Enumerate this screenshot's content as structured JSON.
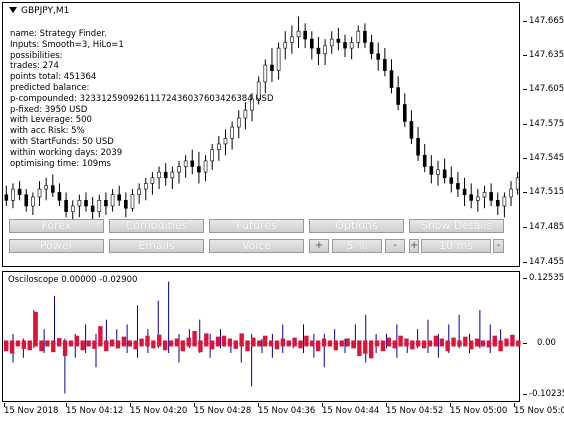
{
  "chart_window": {
    "symbol": "GBPJPY,M1",
    "info_lines": [
      "name: Strategy Finder.",
      "Inputs: Smooth=3, HiLo=1",
      "possibilities:",
      "trades: 274",
      "points total: 451364",
      "predicted balance:",
      "p-compounded: 32331259092611172436037603426384 USD",
      "p-fixed: 3950 USD",
      "with Leverage: 500",
      "with acc Risk: 5%",
      "with StartFunds: 50 USD",
      "within working days: 2039",
      "optimising time: 109ms"
    ]
  },
  "buttons": {
    "row1": [
      {
        "label": "Forex",
        "name": "forex-button"
      },
      {
        "label": "Comodities",
        "name": "comodities-button"
      },
      {
        "label": "Futures",
        "name": "futures-button"
      },
      {
        "label": "Options",
        "name": "options-button"
      },
      {
        "label": "Show Details",
        "name": "show-details-button"
      }
    ],
    "row2": {
      "power": "Power",
      "emails": "Emails",
      "voice": "Voice",
      "risk_plus": "+",
      "risk_value": "5 %",
      "risk_minus": "-",
      "time_plus": "+",
      "time_value": "10 ms",
      "time_minus": "-"
    }
  },
  "oscillator": {
    "title": "Osciloscope 0.00000 -0.02900"
  },
  "colors": {
    "candle": "#000000",
    "osc_bar": "#dc143c",
    "osc_line": "#00008b"
  },
  "chart_data": [
    {
      "type": "candlestick",
      "title": "GBPJPY,M1",
      "y_tick_labels": [
        "147.665",
        "147.635",
        "147.605",
        "147.575",
        "147.545",
        "147.515",
        "147.485",
        "147.455"
      ],
      "ylim": [
        147.445,
        147.68
      ],
      "x_tick_labels": [
        "15 Nov 2018",
        "15 Nov 04:12",
        "15 Nov 04:20",
        "15 Nov 04:28",
        "15 Nov 04:36",
        "15 Nov 04:44",
        "15 Nov 04:52",
        "15 Nov 05:00",
        "15 Nov 05:0"
      ],
      "candles": [
        [
          147.51,
          147.518,
          147.5,
          147.505
        ],
        [
          147.505,
          147.52,
          147.498,
          147.515
        ],
        [
          147.515,
          147.522,
          147.505,
          147.51
        ],
        [
          147.51,
          147.515,
          147.495,
          147.5
        ],
        [
          147.5,
          147.512,
          147.492,
          147.508
        ],
        [
          147.508,
          147.522,
          147.5,
          147.515
        ],
        [
          147.515,
          147.525,
          147.505,
          147.518
        ],
        [
          147.518,
          147.528,
          147.508,
          147.512
        ],
        [
          147.512,
          147.52,
          147.5,
          147.505
        ],
        [
          147.505,
          147.512,
          147.49,
          147.495
        ],
        [
          147.495,
          147.505,
          147.485,
          147.5
        ],
        [
          147.5,
          147.51,
          147.49,
          147.505
        ],
        [
          147.505,
          147.512,
          147.495,
          147.5
        ],
        [
          147.5,
          147.508,
          147.488,
          147.495
        ],
        [
          147.495,
          147.51,
          147.49,
          147.505
        ],
        [
          147.505,
          147.512,
          147.492,
          147.5
        ],
        [
          147.5,
          147.515,
          147.495,
          147.51
        ],
        [
          147.51,
          147.518,
          147.5,
          147.505
        ],
        [
          147.505,
          147.512,
          147.49,
          147.498
        ],
        [
          147.498,
          147.515,
          147.495,
          147.51
        ],
        [
          147.51,
          147.52,
          147.502,
          147.515
        ],
        [
          147.515,
          147.525,
          147.505,
          147.52
        ],
        [
          147.52,
          147.53,
          147.51,
          147.525
        ],
        [
          147.525,
          147.535,
          147.515,
          147.53
        ],
        [
          147.53,
          147.538,
          147.518,
          147.525
        ],
        [
          147.525,
          147.535,
          147.515,
          147.53
        ],
        [
          147.53,
          147.54,
          147.52,
          147.535
        ],
        [
          147.535,
          147.545,
          147.525,
          147.54
        ],
        [
          147.54,
          147.55,
          147.528,
          147.535
        ],
        [
          147.535,
          147.548,
          147.52,
          147.53
        ],
        [
          147.53,
          147.545,
          147.522,
          147.54
        ],
        [
          147.54,
          147.555,
          147.532,
          147.55
        ],
        [
          147.55,
          147.562,
          147.54,
          147.555
        ],
        [
          147.555,
          147.568,
          147.545,
          147.56
        ],
        [
          147.56,
          147.575,
          147.55,
          147.57
        ],
        [
          147.57,
          147.585,
          147.56,
          147.578
        ],
        [
          147.578,
          147.592,
          147.568,
          147.585
        ],
        [
          147.585,
          147.6,
          147.575,
          147.595
        ],
        [
          147.595,
          147.615,
          147.59,
          147.61
        ],
        [
          147.61,
          147.63,
          147.6,
          147.625
        ],
        [
          147.625,
          147.64,
          147.61,
          147.62
        ],
        [
          147.62,
          147.645,
          147.612,
          147.64
        ],
        [
          147.64,
          147.655,
          147.63,
          147.645
        ],
        [
          147.645,
          147.66,
          147.635,
          147.65
        ],
        [
          147.65,
          147.668,
          147.64,
          147.655
        ],
        [
          147.655,
          147.662,
          147.64,
          147.648
        ],
        [
          147.648,
          147.655,
          147.63,
          147.64
        ],
        [
          147.64,
          147.65,
          147.625,
          147.635
        ],
        [
          147.635,
          147.648,
          147.625,
          147.642
        ],
        [
          147.642,
          147.655,
          147.635,
          147.648
        ],
        [
          147.648,
          147.658,
          147.638,
          147.645
        ],
        [
          147.645,
          147.652,
          147.632,
          147.64
        ],
        [
          147.64,
          147.65,
          147.63,
          147.645
        ],
        [
          147.645,
          147.66,
          147.64,
          147.655
        ],
        [
          147.655,
          147.662,
          147.64,
          147.645
        ],
        [
          147.645,
          147.652,
          147.63,
          147.635
        ],
        [
          147.635,
          147.645,
          147.62,
          147.63
        ],
        [
          147.63,
          147.64,
          147.615,
          147.62
        ],
        [
          147.62,
          147.63,
          147.6,
          147.605
        ],
        [
          147.605,
          147.615,
          147.585,
          147.59
        ],
        [
          147.59,
          147.6,
          147.57,
          147.575
        ],
        [
          147.575,
          147.585,
          147.555,
          147.56
        ],
        [
          147.56,
          147.57,
          147.54,
          147.545
        ],
        [
          147.545,
          147.555,
          147.53,
          147.535
        ],
        [
          147.535,
          147.545,
          147.52,
          147.528
        ],
        [
          147.528,
          147.54,
          147.518,
          147.532
        ],
        [
          147.532,
          147.542,
          147.52,
          147.525
        ],
        [
          147.525,
          147.535,
          147.512,
          147.52
        ],
        [
          147.52,
          147.53,
          147.508,
          147.515
        ],
        [
          147.515,
          147.525,
          147.5,
          147.51
        ],
        [
          147.51,
          147.52,
          147.498,
          147.505
        ],
        [
          147.505,
          147.515,
          147.495,
          147.508
        ],
        [
          147.508,
          147.518,
          147.498,
          147.512
        ],
        [
          147.512,
          147.52,
          147.5,
          147.505
        ],
        [
          147.505,
          147.512,
          147.492,
          147.5
        ],
        [
          147.5,
          147.512,
          147.49,
          147.508
        ],
        [
          147.508,
          147.522,
          147.5,
          147.515
        ],
        [
          147.515,
          147.53,
          147.51,
          147.525
        ]
      ]
    },
    {
      "type": "bar",
      "title": "Osciloscope 0.00000 -0.02900",
      "y_tick_labels": [
        "0.12535",
        "0.00",
        "-0.10235"
      ],
      "ylim": [
        -0.125,
        0.15
      ],
      "values": [
        -0.01,
        -0.015,
        0.0,
        -0.005,
        -0.008,
        0.06,
        -0.01,
        0.0,
        -0.012,
        0.005,
        -0.02,
        0.0,
        0.01,
        -0.008,
        0.0,
        -0.005,
        0.03,
        -0.01,
        0.002,
        -0.004,
        0.008,
        0.0,
        -0.006,
        0.004,
        0.01,
        -0.004,
        0.012,
        -0.008,
        0.0,
        0.004,
        -0.01,
        0.006,
        0.02,
        -0.012,
        0.015,
        -0.006,
        0.008,
        0.01,
        0.004,
        -0.005,
        0.015,
        -0.01,
        0.006,
        0.0,
        0.01,
        0.0,
        -0.006,
        0.004,
        0.0,
        0.006,
        -0.004,
        0.01,
        0.0,
        -0.01,
        0.004,
        0.0,
        -0.008,
        0.0,
        0.004,
        -0.004,
        -0.02,
        -0.015,
        -0.025,
        0.0,
        -0.01,
        0.006,
        -0.004,
        0.01,
        0.004,
        -0.006,
        0.0,
        -0.004,
        0.0,
        0.01,
        0.004,
        -0.01,
        0.006,
        0.0,
        0.008,
        -0.006,
        0.004,
        0.0,
        -0.002,
        0.01,
        -0.01,
        0.004,
        0.012,
        0.0
      ],
      "spikes": [
        [
          -0.04,
          0.02
        ],
        [
          -0.03,
          0.01
        ],
        [
          -0.01,
          0.07
        ],
        [
          -0.02,
          0.03
        ],
        [
          -0.01,
          0.1
        ],
        [
          -0.105,
          0.01
        ],
        [
          -0.03,
          0.02
        ],
        [
          -0.02,
          0.04
        ],
        [
          -0.05,
          0.02
        ],
        [
          -0.01,
          0.05
        ],
        [
          -0.01,
          0.03
        ],
        [
          -0.02,
          0.04
        ],
        [
          -0.03,
          0.08
        ],
        [
          -0.02,
          0.03
        ],
        [
          -0.01,
          0.09
        ],
        [
          -0.02,
          0.13
        ],
        [
          -0.04,
          0.02
        ],
        [
          -0.01,
          0.03
        ],
        [
          -0.02,
          0.05
        ],
        [
          -0.03,
          0.02
        ],
        [
          -0.01,
          0.03
        ],
        [
          -0.02,
          0.01
        ],
        [
          -0.04,
          0.02
        ],
        [
          -0.09,
          0.02
        ],
        [
          -0.02,
          0.01
        ],
        [
          -0.03,
          0.02
        ],
        [
          -0.02,
          0.04
        ],
        [
          -0.01,
          0.01
        ],
        [
          -0.02,
          0.04
        ],
        [
          -0.03,
          0.02
        ],
        [
          -0.05,
          0.02
        ],
        [
          -0.01,
          0.03
        ],
        [
          -0.02,
          0.01
        ],
        [
          -0.01,
          0.04
        ],
        [
          -0.04,
          0.06
        ],
        [
          -0.02,
          0.02
        ],
        [
          -0.01,
          0.02
        ],
        [
          -0.03,
          0.04
        ],
        [
          -0.02,
          0.01
        ],
        [
          -0.01,
          0.03
        ],
        [
          -0.02,
          0.05
        ],
        [
          -0.03,
          0.02
        ],
        [
          -0.02,
          0.04
        ],
        [
          -0.01,
          0.06
        ],
        [
          -0.02,
          0.02
        ],
        [
          -0.01,
          0.07
        ],
        [
          -0.02,
          0.04
        ],
        [
          -0.01,
          0.03
        ]
      ]
    }
  ]
}
